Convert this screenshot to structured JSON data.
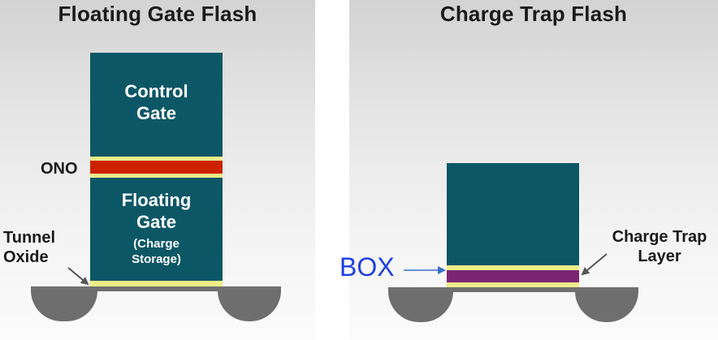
{
  "left_panel": {
    "title": "Floating Gate Flash",
    "control_gate": "Control\nGate",
    "ono_label": "ONO",
    "floating_gate": "Floating\nGate",
    "floating_gate_sub": "(Charge\nStorage)",
    "tunnel_oxide_label": "Tunnel\nOxide"
  },
  "right_panel": {
    "title": "Charge Trap Flash",
    "box_label": "BOX",
    "charge_trap_label": "Charge Trap\nLayer"
  },
  "colors": {
    "gate": "#0c5766",
    "oxide": "#eded88",
    "ono": "#cc2200",
    "trap_layer": "#7b2473",
    "substrate": "#707070",
    "box_label": "#1f3fe0"
  }
}
